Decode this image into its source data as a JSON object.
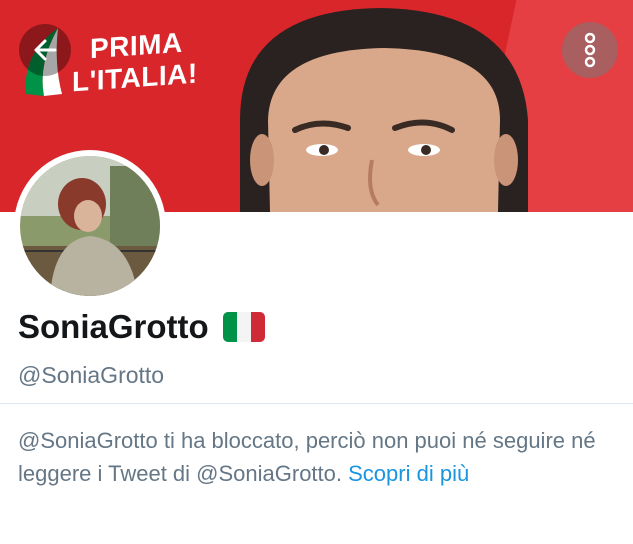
{
  "banner": {
    "badge_line1": "PRIMA",
    "badge_line2": "L'ITALIA!"
  },
  "icons": {
    "back": "arrow-left-icon",
    "more": "more-vertical-icon"
  },
  "profile": {
    "name": "SoniaGrotto",
    "handle": "@SoniaGrotto",
    "flag_colors": [
      "#009246",
      "#ffffff",
      "#ce2b37"
    ]
  },
  "blocked_notice": {
    "text": "@SoniaGrotto ti ha bloccato, perciò non puoi né seguire né leggere i Tweet di @SoniaGrotto.",
    "link_label": "Scopri di più"
  },
  "colors": {
    "banner_red": "#d8262a",
    "link_blue": "#1b95e0",
    "secondary_text": "#657786"
  }
}
